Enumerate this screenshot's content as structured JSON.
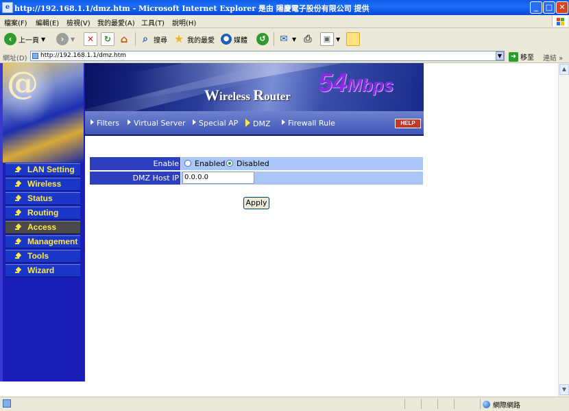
{
  "window": {
    "title": "http://192.168.1.1/dmz.htm - Microsoft Internet Explorer 是由 陽慶電子股份有限公司 提供",
    "min": "_",
    "max": "□",
    "close": "✕"
  },
  "menu": [
    "檔案(F)",
    "編輯(E)",
    "檢視(V)",
    "我的最愛(A)",
    "工具(T)",
    "說明(H)"
  ],
  "toolbar": {
    "back": "上一頁",
    "search": "搜尋",
    "favorites": "我的最愛",
    "media": "媒體"
  },
  "address": {
    "label": "網址(D)",
    "url": "http://192.168.1.1/dmz.htm",
    "go": "移至",
    "links": "連結"
  },
  "banner": {
    "title_big1": "W",
    "title_small1": "ireless ",
    "title_big2": "R",
    "title_small2": "outer",
    "speed": "54",
    "unit": "Mbps"
  },
  "tabs": [
    "Filters",
    "Virtual Server",
    "Special AP",
    "DMZ",
    "Firewall Rule"
  ],
  "help": "HELP",
  "sidebar": [
    "LAN Setting",
    "Wireless",
    "Status",
    "Routing",
    "Access",
    "Management",
    "Tools",
    "Wizard"
  ],
  "form": {
    "enable_label": "Enable",
    "enabled": "Enabled",
    "disabled": "Disabled",
    "selected": "Disabled",
    "host_label": "DMZ Host IP",
    "host_value": "0.0.0.0",
    "apply": "Apply"
  },
  "status": {
    "zone": "網際網路"
  }
}
